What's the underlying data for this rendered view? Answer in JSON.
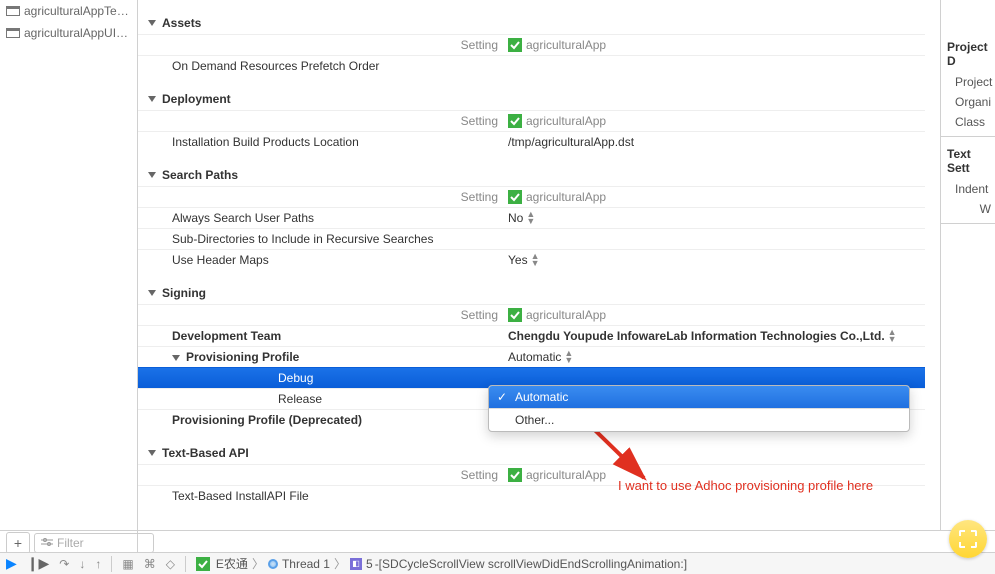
{
  "sidebar": {
    "items": [
      {
        "label": "agriculturalAppTests"
      },
      {
        "label": "agriculturalAppUITe..."
      }
    ]
  },
  "target": "agriculturalApp",
  "sections": {
    "assets": {
      "title": "Assets",
      "setting": "Setting",
      "ondemand": "On Demand Resources Prefetch Order"
    },
    "deployment": {
      "title": "Deployment",
      "setting": "Setting",
      "install": "Installation Build Products Location",
      "install_val": "/tmp/agriculturalApp.dst"
    },
    "search": {
      "title": "Search Paths",
      "setting": "Setting",
      "always": "Always Search User Paths",
      "always_val": "No",
      "subdirs": "Sub-Directories to Include in Recursive Searches",
      "usehdr": "Use Header Maps",
      "usehdr_val": "Yes"
    },
    "signing": {
      "title": "Signing",
      "setting": "Setting",
      "devteam": "Development Team",
      "devteam_val": "Chengdu Youpude InfowareLab Information Technologies Co.,Ltd.",
      "prov": "Provisioning Profile",
      "prov_val": "Automatic",
      "debug": "Debug",
      "release": "Release",
      "prov_dep": "Provisioning Profile (Deprecated)"
    },
    "textapi": {
      "title": "Text-Based API",
      "setting": "Setting",
      "install": "Text-Based InstallAPI File"
    }
  },
  "dropdown": {
    "automatic": "Automatic",
    "other": "Other..."
  },
  "annotation": "I want to use Adhoc provisioning profile here",
  "right": {
    "g1": "Project D",
    "g1_items": [
      "Project F",
      "Organi",
      "Class"
    ],
    "g2": "Text Sett",
    "g2_items": [
      "Indent",
      "W"
    ]
  },
  "filter": "Filter",
  "debugbar": {
    "scheme": "E农通",
    "thread": "Thread 1",
    "frame_no": "5",
    "frame": "-[SDCycleScrollView scrollViewDidEndScrollingAnimation:]"
  }
}
